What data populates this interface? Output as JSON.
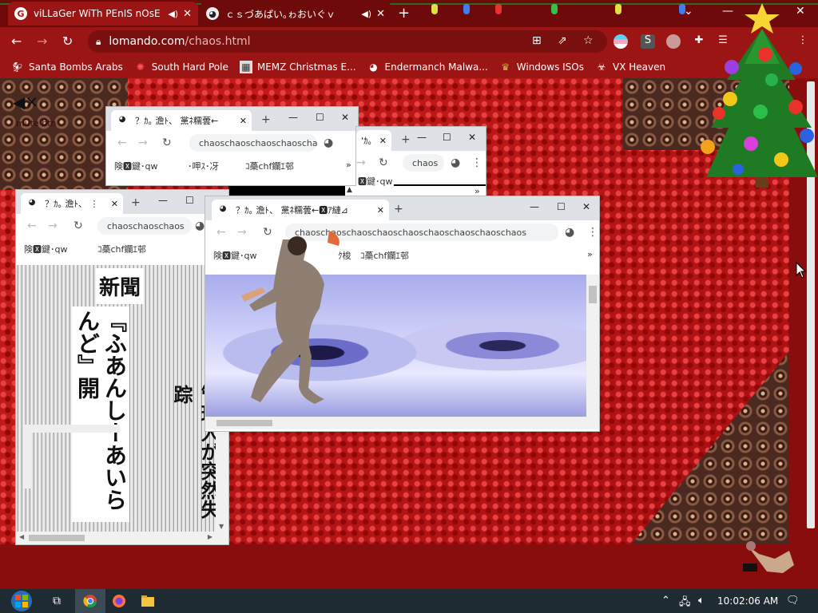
{
  "browser": {
    "tabs": [
      {
        "title": "viLLaGer WiTh PEnIS nOsE -",
        "active": true
      },
      {
        "title": "ｃｓづあぱい｡ゎおいぐｖ",
        "active": false
      }
    ],
    "new_tab_label": "+",
    "address": {
      "host": "lomando.com",
      "path": "/chaos.html"
    },
    "bookmarks": [
      {
        "label": "Santa Bombs Arabs",
        "icon": "chicken-icon"
      },
      {
        "label": "South Hard Pole",
        "icon": "gear-red-icon"
      },
      {
        "label": "MEMZ Christmas E...",
        "icon": "image-icon"
      },
      {
        "label": "Endermanch Malwa...",
        "icon": "panda-icon"
      },
      {
        "label": "Windows ISOs",
        "icon": "trophy-icon"
      },
      {
        "label": "VX Heaven",
        "icon": "biohazard-icon"
      }
    ]
  },
  "page": {
    "mute_label": "mute btn",
    "popups": [
      {
        "id": "popup-a",
        "tab_title": "？ｶ｡ 澹ﾄ、 黨ﾈ糯蕓←",
        "url": "chaoschaoschaoschaoschao",
        "bookmarks": [
          "険🆇鍵･qw",
          "･呷ｽ･冴",
          "ｺ蘽chf鑭ｴ邨"
        ]
      },
      {
        "id": "popup-b",
        "tab_title": "'ｶ｡",
        "url": "chaos",
        "bookmarks": [
          "🆇鍵･qw"
        ]
      },
      {
        "id": "popup-c",
        "tab_title": "？ｶ｡ 澹ﾄ、 ⋮",
        "url": "chaoschaoschaos",
        "bookmarks": [
          "険🆇鍵･qw",
          "ｺ蘽chf鑭ｴ邨"
        ],
        "newspaper": {
          "masthead": "新聞",
          "headline": "『ふあんしーあいらんど』開",
          "subhead": "管理人が突然失踪"
        }
      },
      {
        "id": "popup-d",
        "tab_title": "？ｶ｡ 澹ﾄ、 黨ﾈ糯蕓←🆇ｱ縺⊿",
        "url": "chaoschaoschaoschaoschaoschaoschaoschaoschaos",
        "bookmarks": [
          "険🆇鍵･qw",
          "ｸ梭",
          "ｺ蘽chf鑭ｴ邨"
        ]
      }
    ]
  },
  "taskbar": {
    "time": "10:02:06 AM",
    "apps": [
      "task-view-icon",
      "chrome-icon",
      "firefox-icon",
      "file-explorer-icon"
    ]
  },
  "colors": {
    "chrome_dark": "#6e0a0a",
    "chrome": "#9b1515",
    "page_red": "#b71414"
  }
}
